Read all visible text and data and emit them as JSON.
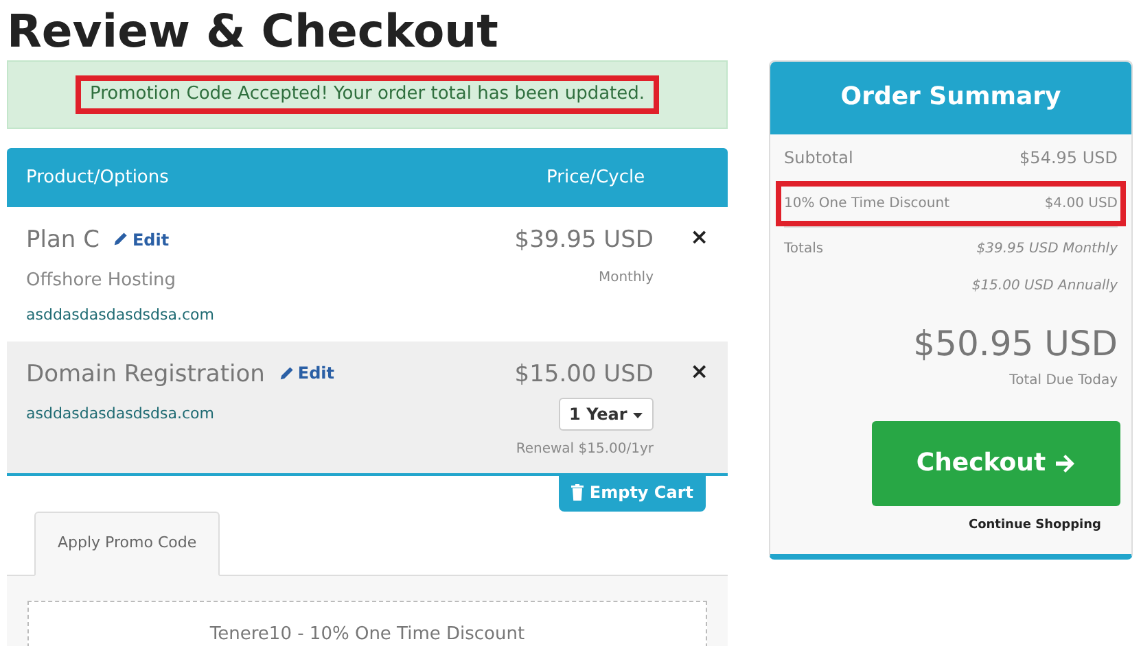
{
  "title": "Review & Checkout",
  "alert": {
    "text": "Promotion Code Accepted! Your order total has been updated.",
    "highlighted": true
  },
  "cart": {
    "columns": [
      "Product/Options",
      "Price/Cycle"
    ],
    "items": [
      {
        "name": "Plan C",
        "edit": "Edit",
        "group": "Offshore Hosting",
        "domain": "asddasdasdasdsdsa.com",
        "price": "$39.95 USD",
        "cycle": "Monthly",
        "remove": "×",
        "shaded": false
      },
      {
        "name": "Domain Registration",
        "edit": "Edit",
        "domain": "asddasdasdasdsdsa.com",
        "price": "$15.00 USD",
        "term": "1 Year",
        "renewal": "Renewal $15.00/1yr",
        "remove": "×",
        "shaded": true
      }
    ],
    "empty_button": "Empty Cart"
  },
  "promo": {
    "tabs": [
      {
        "label": "Apply Promo Code",
        "selected": true
      }
    ],
    "applied": "Tenere10 - 10% One Time Discount"
  },
  "summary": {
    "title": "Order Summary",
    "rows": [
      {
        "label": "Subtotal",
        "value": "$54.95 USD",
        "highlighted": false,
        "kind": "main"
      },
      {
        "label": "10% One Time Discount",
        "value": "$4.00 USD",
        "highlighted": true,
        "kind": "small"
      }
    ],
    "totals_label": "Totals",
    "totals": [
      "$39.95 USD Monthly",
      "$15.00 USD Annually"
    ],
    "total_due": "$50.95 USD",
    "total_due_label": "Total Due Today",
    "checkout": "Checkout",
    "continue": "Continue Shopping"
  }
}
